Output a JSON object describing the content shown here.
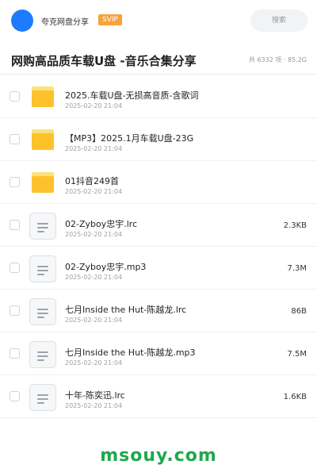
{
  "header": {
    "username": "夸克网盘分享",
    "badge": "SVIP",
    "search_placeholder": "搜索"
  },
  "share": {
    "title": "网购高品质车载U盘 -音乐合集分享",
    "stats": "共 6332 项 · 85.2G"
  },
  "files": [
    {
      "name": "2025.车载U盘-无损高音质-含歌词",
      "date": "2025-02-20 21:04",
      "size": "",
      "type": "folder"
    },
    {
      "name": "【MP3】2025.1月车载U盘-23G",
      "date": "2025-02-20 21:04",
      "size": "",
      "type": "folder"
    },
    {
      "name": "01抖音249首",
      "date": "2025-02-20 21:04",
      "size": "",
      "type": "folder"
    },
    {
      "name": "02-Zyboy忠宇.lrc",
      "date": "2025-02-20 21:04",
      "size": "2.3KB",
      "type": "file"
    },
    {
      "name": "02-Zyboy忠宇.mp3",
      "date": "2025-02-20 21:04",
      "size": "7.3M",
      "type": "file"
    },
    {
      "name": "七月Inside the Hut-陈越龙.lrc",
      "date": "2025-02-20 21:04",
      "size": "86B",
      "type": "file"
    },
    {
      "name": "七月Inside the Hut-陈越龙.mp3",
      "date": "2025-02-20 21:04",
      "size": "7.5M",
      "type": "file"
    },
    {
      "name": "十年-陈奕迅.lrc",
      "date": "2025-02-20 21:04",
      "size": "1.6KB",
      "type": "file"
    }
  ],
  "watermark": "msouy.com",
  "colors": {
    "avatar": "#1e7bff",
    "badge": "#f7a23b",
    "folder": "#fdc22b",
    "watermark": "#1ea84c"
  }
}
